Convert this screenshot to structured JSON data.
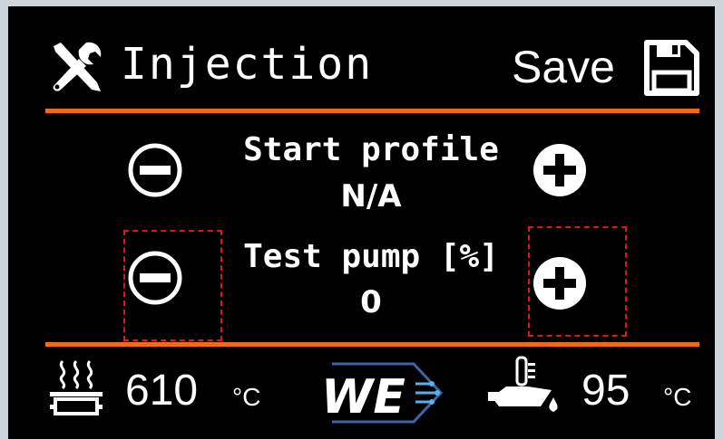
{
  "header": {
    "title": "Injection",
    "save_label": "Save"
  },
  "rows": [
    {
      "label": "Start profile",
      "value": "N/A"
    },
    {
      "label": "Test pump [%]",
      "value": "0"
    }
  ],
  "footer": {
    "temperature_value": "610",
    "temperature_unit": "°C",
    "logo_text": "WE",
    "oil_temperature_value": "95",
    "oil_temperature_unit": "°C"
  },
  "colors": {
    "accent": "#f06a1c",
    "highlight": "#e01515",
    "background": "#000000",
    "foreground": "#ffffff"
  }
}
